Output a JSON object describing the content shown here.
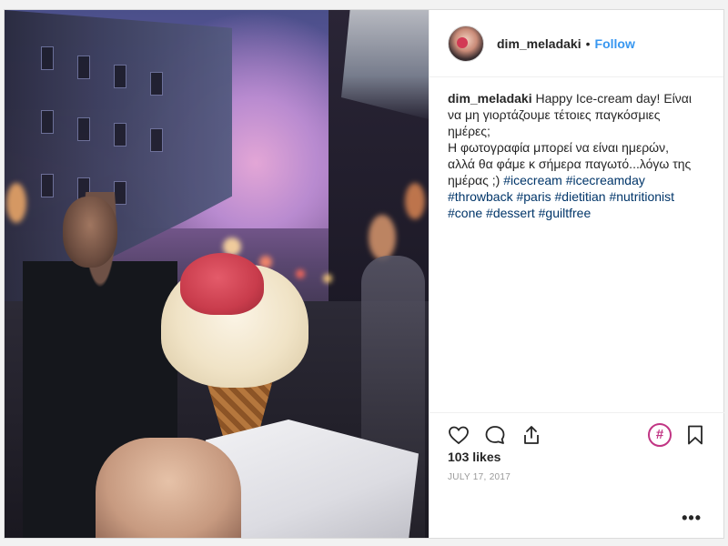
{
  "post": {
    "author": "dim_meladaki",
    "follow_label": "Follow",
    "separator": "•",
    "caption": {
      "user": "dim_meladaki",
      "line1": "Happy Ice-cream day! Είναι",
      "line2": "να μη γιορτάζουμε τέτοιες παγκόσμιες",
      "line3": "ημέρες;",
      "line4": "Η φωτογραφία μπορεί να είναι ημερών,",
      "line5": "αλλά θα φάμε κ σήμερα παγωτό...λόγω της",
      "line6_prefix": "ημέρας ;)",
      "hashtags": [
        "#icecream",
        "#icecreamday",
        "#throwback",
        "#paris",
        "#dietitian",
        "#nutritionist",
        "#cone",
        "#dessert",
        "#guiltfree"
      ]
    },
    "likes": "103 likes",
    "date": "JULY 17, 2017",
    "more_label": "•••",
    "hashtag_badge": "#"
  },
  "icons": {
    "like": "heart-icon",
    "comment": "comment-icon",
    "share": "share-icon",
    "save": "bookmark-icon"
  },
  "colors": {
    "link_blue": "#3897f0",
    "hashtag": "#003569",
    "badge": "#c13584"
  }
}
